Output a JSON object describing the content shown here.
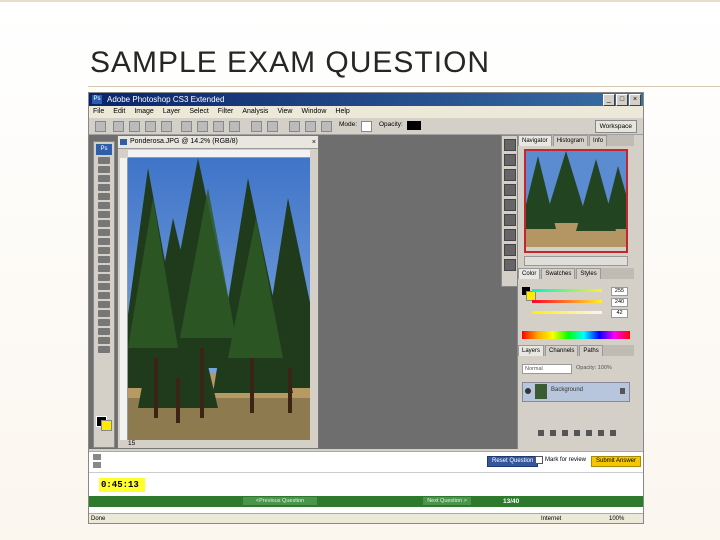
{
  "slide": {
    "title": "SAMPLE EXAM QUESTION"
  },
  "photoshop": {
    "window_title": "Adobe Photoshop CS3 Extended",
    "menu": [
      "File",
      "Edit",
      "Image",
      "Layer",
      "Select",
      "Filter",
      "Analysis",
      "View",
      "Window",
      "Help"
    ],
    "options_bar": {
      "mode_label": "Mode:",
      "opacity_label": "Opacity:",
      "workspace_label": "Workspace"
    },
    "document": {
      "tab_title": "Ponderosa.JPG @ 14.2% (RGB/8)",
      "zoom_status": "15"
    },
    "panels": {
      "navigator_tabs": [
        "Navigator",
        "Histogram",
        "Info"
      ],
      "color_tabs": [
        "Color",
        "Swatches",
        "Styles"
      ],
      "color_values": [
        "255",
        "240",
        "42"
      ],
      "layers_tabs": [
        "Layers",
        "Channels",
        "Paths"
      ],
      "blend_mode": "Normal",
      "opacity": "Opacity: 100%",
      "layer_name": "Background"
    }
  },
  "exam": {
    "buttons": {
      "reset": "Reset Question",
      "review": "Mark for review",
      "submit": "Submit Answer",
      "previous": "<Previous Question",
      "next": "Next Question >"
    },
    "timer": "0:45:13",
    "question_counter": "13/40"
  },
  "browser_status": {
    "zone": "Done",
    "internet": "Internet",
    "zoom": "100%"
  }
}
